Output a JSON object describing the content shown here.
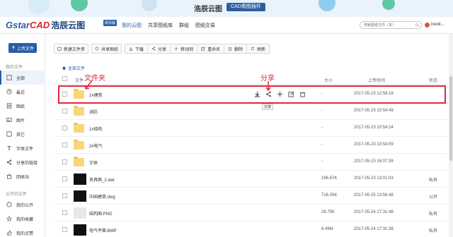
{
  "banner": {
    "brand_text": "浩辰云图",
    "badge_text": "CAD看图插件"
  },
  "header": {
    "logo_main": "Gstar",
    "logo_accent": "CAD",
    "logo_cn": "浩辰云图",
    "logo_tag": "网页版",
    "nav": [
      "我的云图",
      "共享图纸库",
      "群组",
      "图纸交易"
    ],
    "search_placeholder": "搜索图纸文件（夹）",
    "user_name": "lovok..."
  },
  "sidebar": {
    "upload_label": "上传文件",
    "section_mine": "我的文件",
    "items": [
      {
        "label": "全部",
        "icon": "all-files-icon"
      },
      {
        "label": "最近",
        "icon": "clock-icon"
      },
      {
        "label": "图纸",
        "icon": "drawing-icon"
      },
      {
        "label": "图片",
        "icon": "image-icon"
      },
      {
        "label": "其它",
        "icon": "other-icon"
      },
      {
        "label": "字体文件",
        "icon": "font-icon"
      },
      {
        "label": "分享的链接",
        "icon": "share-link-icon"
      },
      {
        "label": "回收站",
        "icon": "trash-icon"
      }
    ],
    "section_public": "公开的文件",
    "public_items": [
      {
        "label": "我的公开",
        "icon": "public-icon"
      },
      {
        "label": "我的收藏",
        "icon": "star-icon"
      },
      {
        "label": "我的点赞",
        "icon": "like-icon"
      }
    ]
  },
  "toolbar": {
    "new_folder": "新建文件夹",
    "share_drawing": "共享图纸",
    "download": "下载",
    "share": "分享",
    "move": "移动到",
    "rename": "重命名",
    "delete": "删除",
    "refresh": "刷新"
  },
  "breadcrumb": "全部文件",
  "table": {
    "col_file": "文件",
    "col_size": "大小",
    "col_time": "上传时间",
    "col_status": "状态",
    "rows": [
      {
        "name": "1#建筑",
        "size": "-",
        "time": "2017-05-23 12:58:18",
        "status": "",
        "type": "folder"
      },
      {
        "name": "消防",
        "size": "-",
        "time": "2017-05-23 10:54:49",
        "status": "",
        "type": "folder"
      },
      {
        "name": "1#结构",
        "size": "-",
        "time": "2017-05-23 10:54:24",
        "status": "",
        "type": "folder"
      },
      {
        "name": "2#电气",
        "size": "-",
        "time": "2017-05-23 10:54:09",
        "status": "",
        "type": "folder"
      },
      {
        "name": "字体",
        "size": "-",
        "time": "2017-05-15 16:07:39",
        "status": "",
        "type": "folder"
      },
      {
        "name": "夹具图_2.dwt",
        "size": "196.67K",
        "time": "2017-05-23 13:01:03",
        "status": "私有",
        "type": "file"
      },
      {
        "name": "中国建筑.dwg",
        "size": "716.05K",
        "time": "2017-05-25 13:56:48",
        "status": "公开",
        "type": "file"
      },
      {
        "name": "结构图.PNG",
        "size": "26.75K",
        "time": "2017-05-24 17:31:48",
        "status": "私有",
        "type": "image"
      },
      {
        "name": "电气平面.BMP",
        "size": "6.49M",
        "time": "2017-05-24 17:31:38",
        "status": "私有",
        "type": "file"
      }
    ]
  },
  "annotations": {
    "left_label": "文件夹",
    "right_label": "分享",
    "tooltip": "分享"
  },
  "colors": {
    "brand_blue": "#2a5da8",
    "annotation_red": "#e0283a",
    "folder_yellow": "#f8d67a"
  }
}
